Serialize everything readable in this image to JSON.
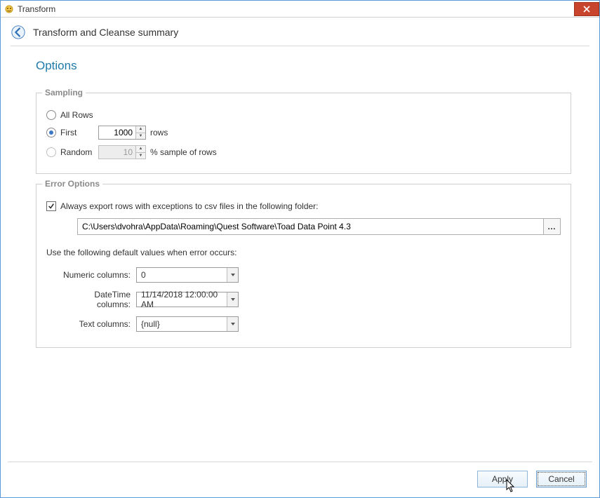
{
  "window": {
    "title": "Transform"
  },
  "header": {
    "page_title": "Transform and Cleanse summary"
  },
  "options": {
    "heading": "Options",
    "sampling": {
      "legend": "Sampling",
      "all_label": "All Rows",
      "first_label": "First",
      "first_value": "1000",
      "first_suffix": "rows",
      "random_label": "Random",
      "random_value": "10",
      "random_suffix": "% sample of rows",
      "selected": "first"
    },
    "error": {
      "legend": "Error Options",
      "export_label": "Always export rows with exceptions to csv files in the following folder:",
      "export_checked": true,
      "path": "C:\\Users\\dvohra\\AppData\\Roaming\\Quest Software\\Toad Data Point 4.3",
      "defaults_label": "Use the following default values when error occurs:",
      "numeric": {
        "label": "Numeric columns:",
        "value": "0"
      },
      "datetime": {
        "label": "DateTime columns:",
        "value": "11/14/2018 12:00:00 AM"
      },
      "text": {
        "label": "Text columns:",
        "value": "{null}"
      }
    }
  },
  "footer": {
    "apply": "Apply",
    "cancel": "Cancel"
  }
}
